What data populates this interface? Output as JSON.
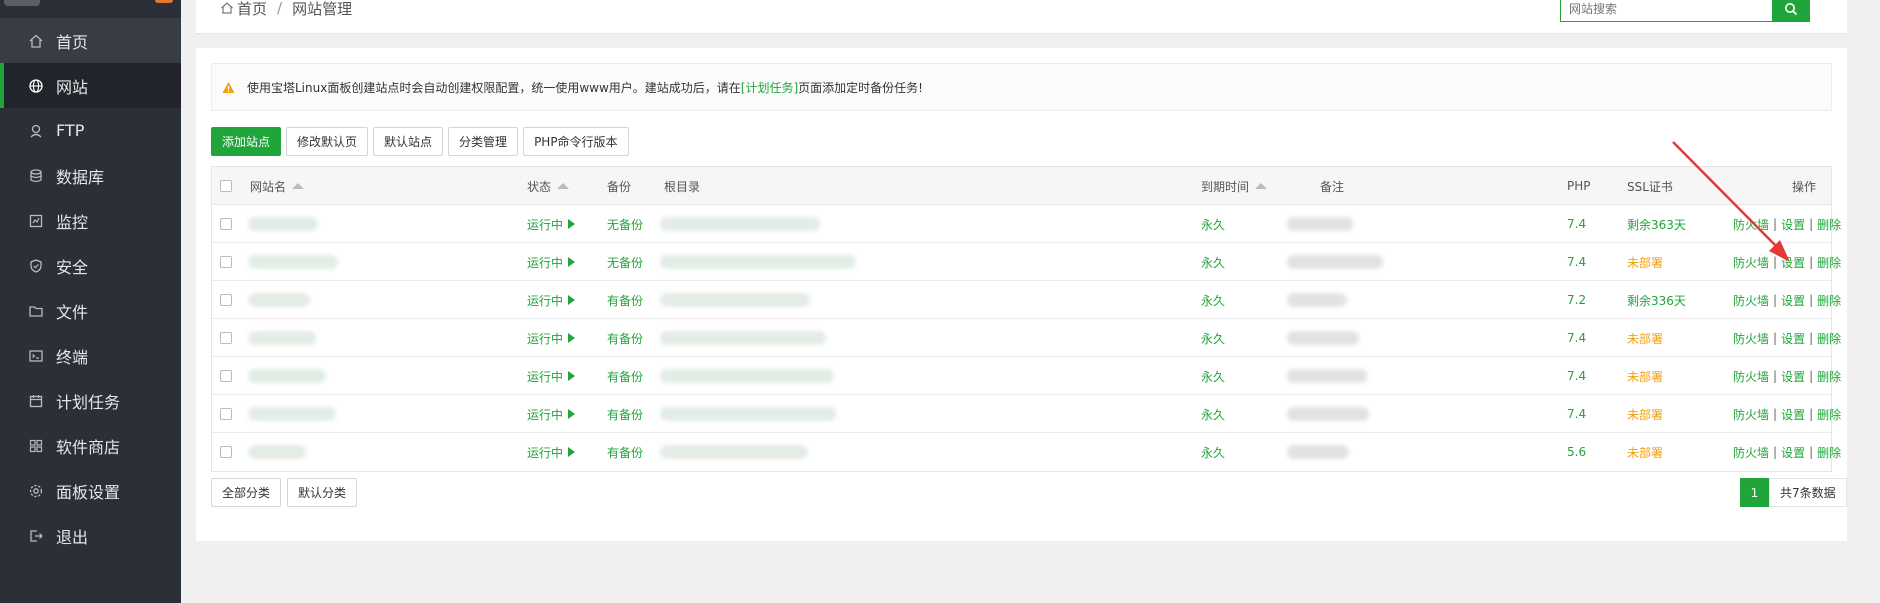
{
  "sidebar": {
    "items": [
      {
        "label": "首页",
        "icon": "home-icon"
      },
      {
        "label": "网站",
        "icon": "globe-icon"
      },
      {
        "label": "FTP",
        "icon": "ftp-icon"
      },
      {
        "label": "数据库",
        "icon": "database-icon"
      },
      {
        "label": "监控",
        "icon": "monitor-icon"
      },
      {
        "label": "安全",
        "icon": "shield-icon"
      },
      {
        "label": "文件",
        "icon": "folder-icon"
      },
      {
        "label": "终端",
        "icon": "terminal-icon"
      },
      {
        "label": "计划任务",
        "icon": "calendar-icon"
      },
      {
        "label": "软件商店",
        "icon": "grid-icon"
      },
      {
        "label": "面板设置",
        "icon": "gear-icon"
      },
      {
        "label": "退出",
        "icon": "logout-icon"
      }
    ],
    "active": "网站"
  },
  "breadcrumb": {
    "home": "首页",
    "separator": "/",
    "current": "网站管理"
  },
  "search": {
    "placeholder": "网站搜索"
  },
  "notice": {
    "text_before": "使用宝塔Linux面板创建站点时会自动创建权限配置，统一使用www用户。建站成功后，请在",
    "link": "[计划任务]",
    "text_after": "页面添加定时备份任务!"
  },
  "toolbar": {
    "add_site": "添加站点",
    "edit_default_page": "修改默认页",
    "default_site": "默认站点",
    "category_manage": "分类管理",
    "php_cli_version": "PHP命令行版本"
  },
  "table": {
    "headers": {
      "name": "网站名",
      "status": "状态",
      "backup": "备份",
      "root": "根目录",
      "expire": "到期时间",
      "remark": "备注",
      "php": "PHP",
      "ssl": "SSL证书",
      "actions": "操作"
    },
    "rows": [
      {
        "status": "运行中",
        "backup": "无备份",
        "expire": "永久",
        "php": "7.4",
        "ssl": "剩余363天",
        "ssl_state": "ok"
      },
      {
        "status": "运行中",
        "backup": "无备份",
        "expire": "永久",
        "php": "7.4",
        "ssl": "未部署",
        "ssl_state": "none"
      },
      {
        "status": "运行中",
        "backup": "有备份",
        "expire": "永久",
        "php": "7.2",
        "ssl": "剩余336天",
        "ssl_state": "ok"
      },
      {
        "status": "运行中",
        "backup": "有备份",
        "expire": "永久",
        "php": "7.4",
        "ssl": "未部署",
        "ssl_state": "none"
      },
      {
        "status": "运行中",
        "backup": "有备份",
        "expire": "永久",
        "php": "7.4",
        "ssl": "未部署",
        "ssl_state": "none"
      },
      {
        "status": "运行中",
        "backup": "有备份",
        "expire": "永久",
        "php": "7.4",
        "ssl": "未部署",
        "ssl_state": "none"
      },
      {
        "status": "运行中",
        "backup": "有备份",
        "expire": "永久",
        "php": "5.6",
        "ssl": "未部署",
        "ssl_state": "none"
      }
    ],
    "row_actions": {
      "firewall": "防火墙",
      "settings": "设置",
      "delete": "删除",
      "separator": "|"
    }
  },
  "footer": {
    "all_categories": "全部分类",
    "default_category": "默认分类",
    "page": "1",
    "total": "共7条数据"
  },
  "colors": {
    "accent": "#20a53a",
    "warning": "#f0a10a",
    "sidebar": "#2b2f38",
    "annotation_arrow": "#e53935"
  }
}
